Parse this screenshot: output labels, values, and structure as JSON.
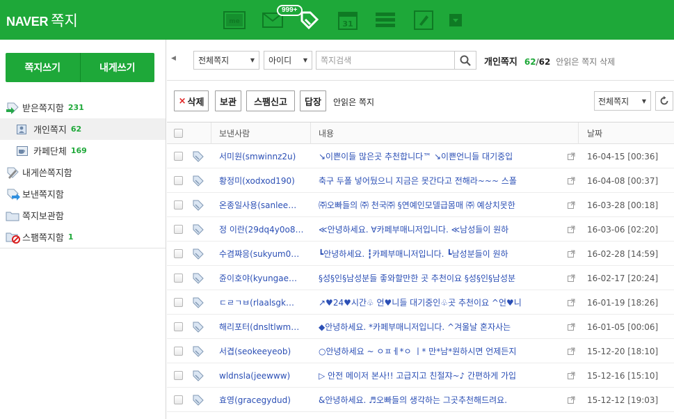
{
  "header": {
    "brand": "NAVER",
    "title": "쪽지",
    "notification_badge": "999+",
    "icons": [
      "memo-icon",
      "mail-icon",
      "message-new-icon",
      "calendar-icon",
      "list-icon",
      "note-icon",
      "dropdown-icon"
    ],
    "calendar_day": "31"
  },
  "sidebar": {
    "write_button": "쪽지쓰기",
    "self_write_button": "내게쓰기",
    "folders": [
      {
        "label": "받은쪽지함",
        "count": "231",
        "icon": "inbox-icon",
        "indent": false,
        "selected": false
      },
      {
        "label": "개인쪽지",
        "count": "62",
        "icon": "person-icon",
        "indent": true,
        "selected": true
      },
      {
        "label": "카페단체",
        "count": "169",
        "icon": "cafe-icon",
        "indent": true,
        "selected": false
      },
      {
        "label": "내게쓴쪽지함",
        "count": "",
        "icon": "self-note-icon",
        "indent": false,
        "selected": false
      },
      {
        "label": "보낸쪽지함",
        "count": "",
        "icon": "sent-icon",
        "indent": false,
        "selected": false
      },
      {
        "label": "쪽지보관함",
        "count": "",
        "icon": "folder-icon",
        "indent": false,
        "selected": false
      },
      {
        "label": "스팸쪽지함",
        "count": "1",
        "icon": "spam-icon",
        "indent": false,
        "selected": false
      }
    ]
  },
  "search": {
    "filter_select": "전체쪽지",
    "field_select": "아이디",
    "placeholder": "쪽지검색",
    "box_name": "개인쪽지",
    "count_current": "62",
    "count_total": "62",
    "delete_unread": "안읽은 쪽지 삭제"
  },
  "toolbar": {
    "delete": "삭제",
    "keep": "보관",
    "spam_report": "스팸신고",
    "reply": "답장",
    "unread_label": "안읽은 쪽지",
    "view_select": "전체쪽지"
  },
  "table": {
    "col_sender": "보낸사람",
    "col_content": "내용",
    "col_date": "날짜",
    "rows": [
      {
        "sender": "서미원(smwinnz2u)",
        "content": "↘이쁜이들 많은곳 추천합니다™ ↘이쁜언니들 대기중입",
        "date": "16-04-15 [00:36]"
      },
      {
        "sender": "황정미(xodxod190)",
        "content": "축구 두폴 넣어뒀으니 지금은 못간다고 전해라~~~ 스폴",
        "date": "16-04-08 [00:37]"
      },
      {
        "sender": "온종일사용(sanlee…",
        "content": "㈜오빠들의 ㈜ 천국㈜ §연예인모델급몸매 ㈜ 예상치못한",
        "date": "16-03-28 [00:18]"
      },
      {
        "sender": "정 이란(29dq4y0o8…",
        "content": "≪안녕하세요. ∀카페부매니저입니다. ≪남성들이 원하",
        "date": "16-03-06 [02:20]"
      },
      {
        "sender": "수겸쨔응(sukyum0…",
        "content": "┗안녕하세요. ┇카페부매니저입니다. ┗남성분들이 원하",
        "date": "16-02-28 [14:59]"
      },
      {
        "sender": "쥰이호야(kyungae…",
        "content": "§성§인§남성분들 좋와할만한 곳 추천이요 §성§인§남성분",
        "date": "16-02-17 [20:24]"
      },
      {
        "sender": "ㄷㄹㄱㅂ(rlaalsgk…",
        "content": "↗♥24♥시간♧ 언♥니들 대기중인♧곳 추천이요 ^언♥니",
        "date": "16-01-19 [18:26]"
      },
      {
        "sender": "해리포터(dnsltlwm…",
        "content": "◆안녕하세요. *카페부매니저입니다. ^겨울날 혼자사는",
        "date": "16-01-05 [00:06]"
      },
      {
        "sender": "서겹(seokeeyeob)",
        "content": "○안녕하세요 ~ ㅇㅍㅔ*ㅇ ㅣ* 만*남*원하시면 언제든지",
        "date": "15-12-20 [18:10]"
      },
      {
        "sender": "wldnsla(jeewww)",
        "content": "▷ 안전 메이저 본사!! 고급지고 친절쟈~♪ 간편하게 가입",
        "date": "15-12-16 [15:10]"
      },
      {
        "sender": "효영(gracegydud)",
        "content": "&안녕하세요. ♬오빠들의 생각하는 그곳추천해드려요.",
        "date": "15-12-12 [19:03]"
      }
    ]
  }
}
